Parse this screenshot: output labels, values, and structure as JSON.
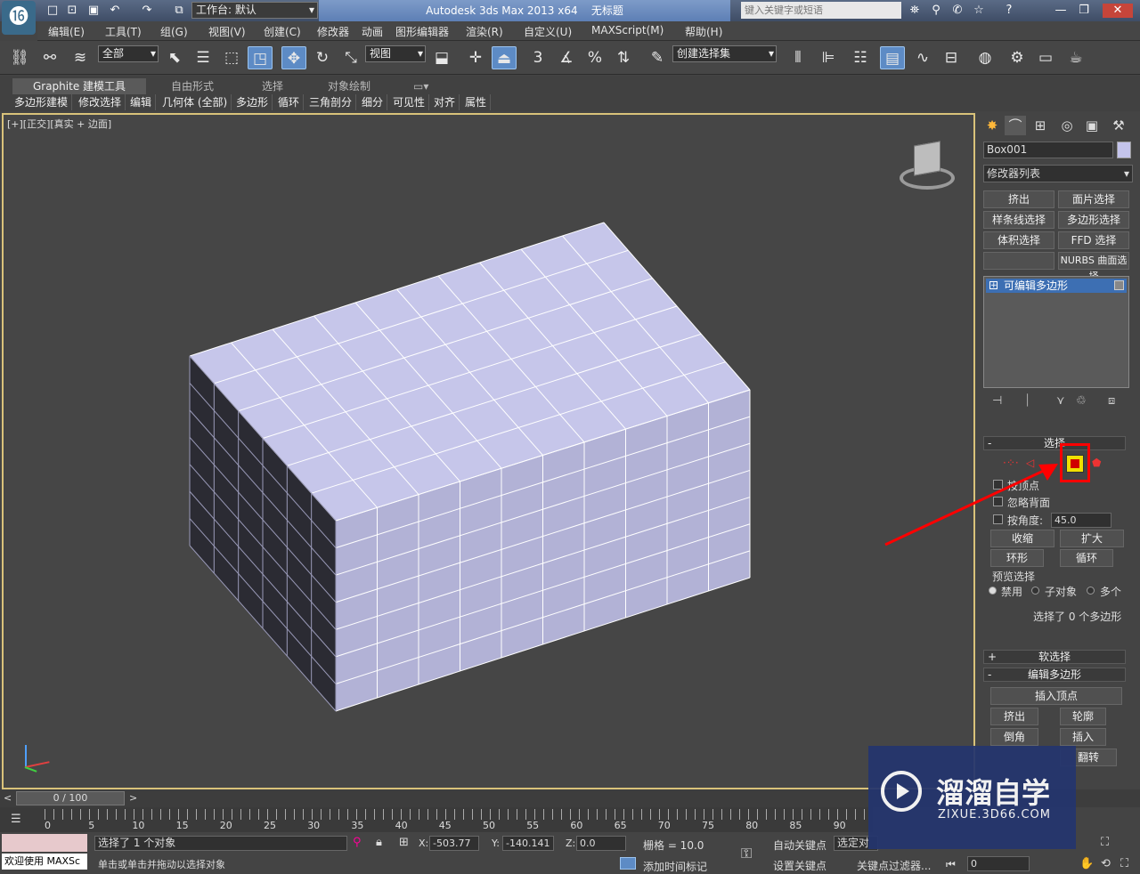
{
  "window": {
    "app_title": "Autodesk 3ds Max  2013 x64",
    "doc_title": "无标题",
    "workspace": "工作台: 默认",
    "search_placeholder": "键入关键字或短语"
  },
  "menus": [
    "编辑(E)",
    "工具(T)",
    "组(G)",
    "视图(V)",
    "创建(C)",
    "修改器",
    "动画",
    "图形编辑器",
    "渲染(R)",
    "自定义(U)",
    "MAXScript(M)",
    "帮助(H)"
  ],
  "toolbar": {
    "selection_filter": "全部",
    "ref_coord": "视图",
    "named_selection": "创建选择集",
    "snaps": {
      "snap3": "3",
      "angle": "%"
    }
  },
  "ribbon": {
    "tabs": [
      "Graphite 建模工具",
      "自由形式",
      "选择",
      "对象绘制"
    ],
    "subtabs": [
      "多边形建模",
      "修改选择",
      "编辑",
      "几何体 (全部)",
      "多边形",
      "循环",
      "三角剖分",
      "细分",
      "可见性",
      "对齐",
      "属性"
    ]
  },
  "viewport": {
    "label": "[+][正交][真实 + 边面]"
  },
  "command_panel": {
    "object_name": "Box001",
    "modifier_list": "修改器列表",
    "modifier_buttons": [
      "挤出",
      "面片选择",
      "样条线选择",
      "多边形选择",
      "体积选择",
      "FFD 选择",
      "",
      "NURBS 曲面选择"
    ],
    "stack_item": "可编辑多边形",
    "selection_rollout": {
      "title": "选择",
      "by_vertex": "按顶点",
      "ignore_backfacing": "忽略背面",
      "by_angle": "按角度:",
      "angle_value": "45.0",
      "shrink": "收缩",
      "grow": "扩大",
      "ring": "环形",
      "loop": "循环",
      "preview_title": "预览选择",
      "preview_off": "禁用",
      "preview_sub": "子对象",
      "preview_multi": "多个",
      "status": "选择了 0 个多边形"
    },
    "soft_selection": "软选择",
    "edit_polygons": "编辑多边形",
    "insert_vertex": "插入顶点",
    "ops": [
      "挤出",
      "轮廓",
      "倒角",
      "插入",
      "翻转"
    ]
  },
  "timeline": {
    "frame": "0 / 100",
    "ticks": [
      "0",
      "5",
      "10",
      "15",
      "20",
      "25",
      "30",
      "35",
      "40",
      "45",
      "50",
      "55",
      "60",
      "65",
      "70",
      "75",
      "80",
      "85",
      "90"
    ]
  },
  "status": {
    "selected": "选择了 1 个对象",
    "prompt": "单击或单击并拖动以选择对象",
    "welcome": "欢迎使用 MAXSc",
    "x_label": "X:",
    "x": "-503.77",
    "y_label": "Y:",
    "y": "-140.141",
    "z_label": "Z:",
    "z": "0.0",
    "grid": "栅格 = 10.0",
    "auto_key": "自动关键点",
    "set_key": "设置关键点",
    "selected_obj": "选定对",
    "add_time_tag": "添加时间标记",
    "key_filter": "关键点过滤器...",
    "frame_field": "0"
  },
  "watermark": {
    "name": "溜溜自学",
    "url": "ZIXUE.3D66.COM"
  },
  "colors": {
    "highlight": "#e8d200",
    "annotation": "#ff0000",
    "active_tool": "#5d8bc5"
  }
}
